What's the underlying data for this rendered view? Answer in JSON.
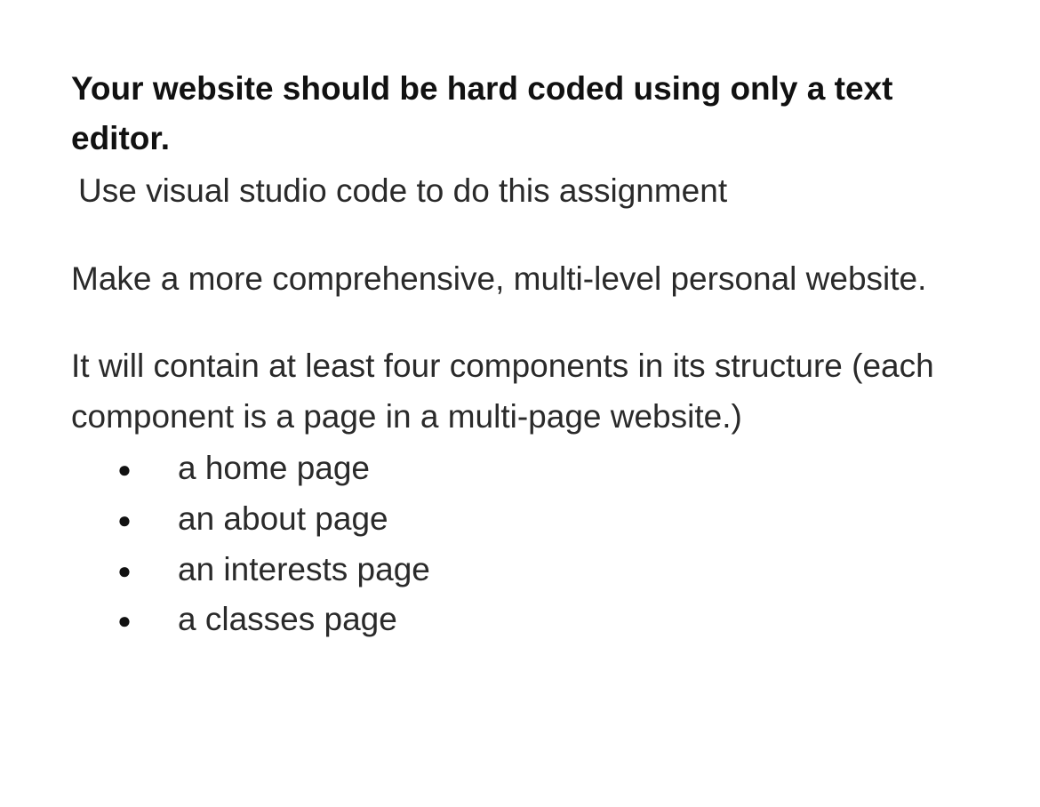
{
  "heading": "Your website should be hard coded using only a text editor.",
  "paragraph1": "Use visual studio code to do this assignment",
  "paragraph2": "Make a more comprehensive, multi-level personal website.",
  "paragraph3": "It will contain at least four components in its structure (each component is a page in a multi-page website.)",
  "bullets": {
    "b1": "a home page",
    "b2": "an about page",
    "b3": "an interests page",
    "b4": "a classes page"
  }
}
